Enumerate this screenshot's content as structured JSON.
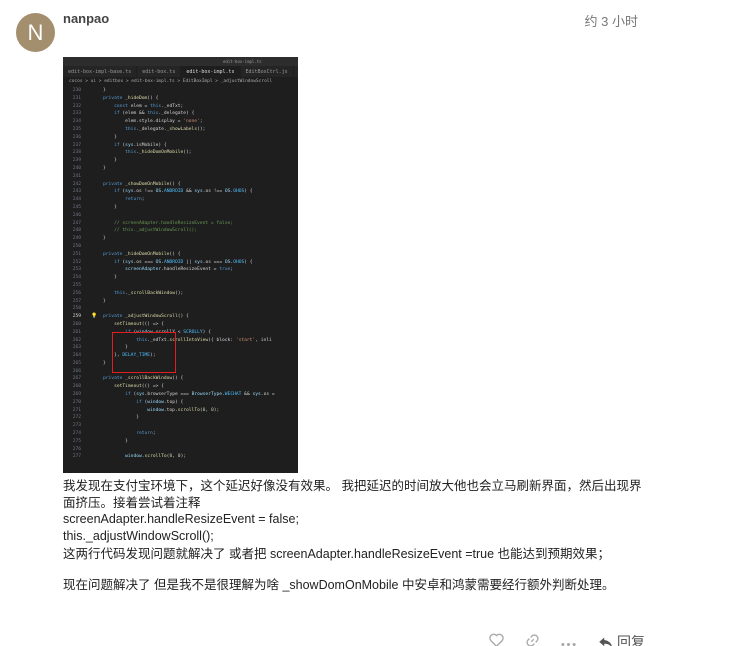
{
  "post": {
    "avatar_letter": "N",
    "avatar_color": "#a38e6e",
    "username": "nanpao",
    "timestamp": "约 3 小时"
  },
  "screenshot": {
    "window_title": "edit-box-impl.ts",
    "tabs": [
      "edit-box-impl-base.ts",
      "edit-box.ts",
      "edit-box-impl.ts",
      "EditBoxCtrl.js"
    ],
    "active_tab": 2,
    "breadcrumb": "cocos > ui > editbox > edit-box-impl.ts > EditBoxImpl > _adjustWindowScroll",
    "lines": [
      {
        "n": "230",
        "code": "}"
      },
      {
        "n": "231",
        "code": "private _hideDom() {"
      },
      {
        "n": "232",
        "code": "    const elem = this._edTxt;"
      },
      {
        "n": "233",
        "code": "    if (elem && this._delegate) {"
      },
      {
        "n": "234",
        "code": "        elem.style.display = 'none';"
      },
      {
        "n": "235",
        "code": "        this._delegate._showLabels();"
      },
      {
        "n": "236",
        "code": "    }"
      },
      {
        "n": "237",
        "code": "    if (sys.isMobile) {"
      },
      {
        "n": "238",
        "code": "        this._hideDomOnMobile();"
      },
      {
        "n": "239",
        "code": "    }"
      },
      {
        "n": "240",
        "code": "}"
      },
      {
        "n": "241",
        "code": ""
      },
      {
        "n": "242",
        "code": "private _showDomOnMobile() {"
      },
      {
        "n": "243",
        "code": "    if (sys.os !== OS.ANDROID && sys.os !== OS.OHOS) {"
      },
      {
        "n": "244",
        "code": "        return;"
      },
      {
        "n": "245",
        "code": "    }"
      },
      {
        "n": "246",
        "code": ""
      },
      {
        "n": "247",
        "code": "    // screenAdapter.handleResizeEvent = false;"
      },
      {
        "n": "248",
        "code": "    // this._adjustWindowScroll();"
      },
      {
        "n": "249",
        "code": "}"
      },
      {
        "n": "250",
        "code": ""
      },
      {
        "n": "251",
        "code": "private _hideDomOnMobile() {"
      },
      {
        "n": "252",
        "code": "    if (sys.os === OS.ANDROID || sys.os === OS.OHOS) {"
      },
      {
        "n": "253",
        "code": "        screenAdapter.handleResizeEvent = true;"
      },
      {
        "n": "254",
        "code": "    }"
      },
      {
        "n": "255",
        "code": ""
      },
      {
        "n": "256",
        "code": "    this._scrollBackWindow();"
      },
      {
        "n": "257",
        "code": "}"
      },
      {
        "n": "258",
        "code": ""
      },
      {
        "n": "259",
        "code": "private _adjustWindowScroll() {"
      },
      {
        "n": "260",
        "code": "    setTimeout(() => {"
      },
      {
        "n": "261",
        "code": "        if (window.scrollY < SCROLLY) {"
      },
      {
        "n": "262",
        "code": "            this._edTxt.scrollIntoView({ block: 'start', inli"
      },
      {
        "n": "263",
        "code": "        }"
      },
      {
        "n": "264",
        "code": "    }, DELAY_TIME);"
      },
      {
        "n": "265",
        "code": "}"
      },
      {
        "n": "266",
        "code": ""
      },
      {
        "n": "267",
        "code": "private _scrollBackWindow() {"
      },
      {
        "n": "268",
        "code": "    setTimeout(() => {"
      },
      {
        "n": "269",
        "code": "        if (sys.browserType === BrowserType.WECHAT && sys.os ="
      },
      {
        "n": "270",
        "code": "            if (window.top) {"
      },
      {
        "n": "271",
        "code": "                window.top.scrollTo(0, 0);"
      },
      {
        "n": "272",
        "code": "            }"
      },
      {
        "n": "273",
        "code": ""
      },
      {
        "n": "274",
        "code": "            return;"
      },
      {
        "n": "275",
        "code": "        }"
      },
      {
        "n": "276",
        "code": ""
      },
      {
        "n": "277",
        "code": "        window.scrollTo(0, 0);"
      }
    ]
  },
  "body": {
    "paragraph1": "我发现在支付宝环境下，这个延迟好像没有效果。 我把延迟的时间放大他也会立马刷新界面，然后出现界面挤压。接着尝试着注释",
    "code1": "screenAdapter.handleResizeEvent = false;",
    "code2": "this._adjustWindowScroll();",
    "paragraph2": "这两行代码发现问题就解决了 或者把 screenAdapter.handleResizeEvent =true 也能达到预期效果；",
    "paragraph3": "现在问题解决了 但是我不是很理解为啥 _showDomOnMobile 中安卓和鸿蒙需要经行额外判断处理。"
  },
  "actions": {
    "like_icon": "heart-icon",
    "link_icon": "link-icon",
    "more_icon": "ellipsis-icon",
    "reply_icon": "reply-arrow-icon",
    "reply_label": "回复"
  }
}
